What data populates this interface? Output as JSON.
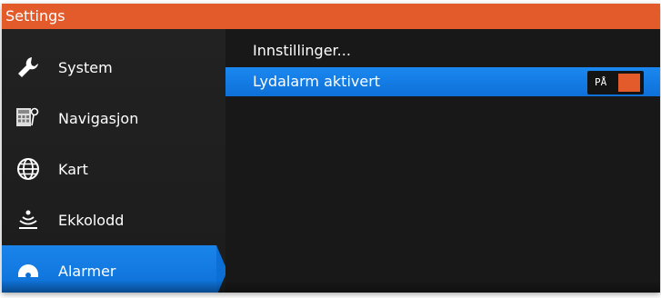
{
  "window": {
    "title": "Settings"
  },
  "sidebar": {
    "items": [
      {
        "label": "System",
        "icon": "wrench-icon"
      },
      {
        "label": "Navigasjon",
        "icon": "calculator-pin-icon"
      },
      {
        "label": "Kart",
        "icon": "globe-icon"
      },
      {
        "label": "Ekkolodd",
        "icon": "sonar-icon"
      },
      {
        "label": "Alarmer",
        "icon": "alarm-icon",
        "selected": true
      }
    ]
  },
  "main": {
    "rows": [
      {
        "label": "Innstillinger..."
      },
      {
        "label": "Lydalarm aktivert",
        "selected": true,
        "toggle": {
          "label": "PÅ",
          "on": true
        }
      }
    ]
  },
  "colors": {
    "title_bar": "#e35b2b",
    "selection": "#1a84ea",
    "background": "#181818",
    "toggle_on": "#e35b2b"
  }
}
